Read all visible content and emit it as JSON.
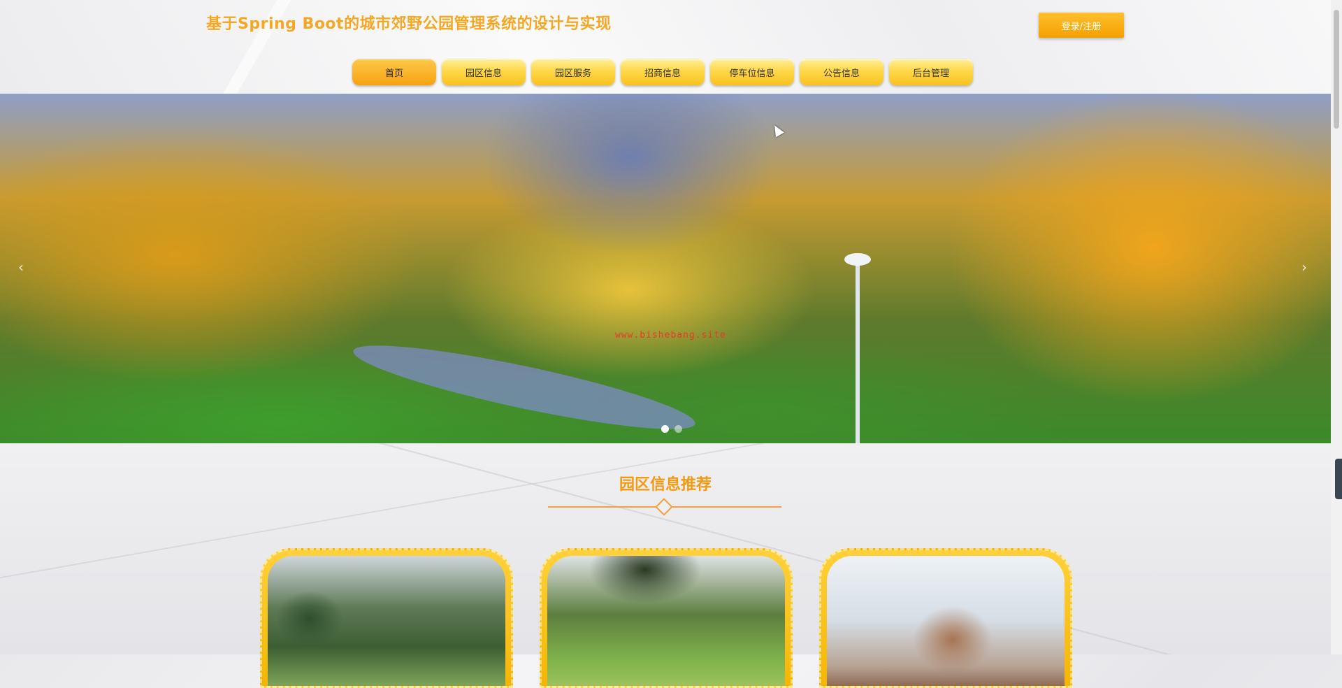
{
  "header": {
    "title": "基于Spring Boot的城市郊野公园管理系统的设计与实现",
    "login_label": "登录/注册"
  },
  "nav": {
    "items": [
      {
        "label": "首页"
      },
      {
        "label": "园区信息"
      },
      {
        "label": "园区服务"
      },
      {
        "label": "招商信息"
      },
      {
        "label": "停车位信息"
      },
      {
        "label": "公告信息"
      },
      {
        "label": "后台管理"
      }
    ]
  },
  "banner": {
    "watermark": "www.bishebang.site",
    "prev_icon": "chevron-left-icon",
    "next_icon": "chevron-right-icon",
    "slide_count": 2,
    "active_slide": 1
  },
  "section": {
    "title": "园区信息推荐"
  },
  "colors": {
    "accent": "#f5a623",
    "nav_gradient_top": "#fff0a0",
    "nav_gradient_bottom": "#f7c21e"
  }
}
